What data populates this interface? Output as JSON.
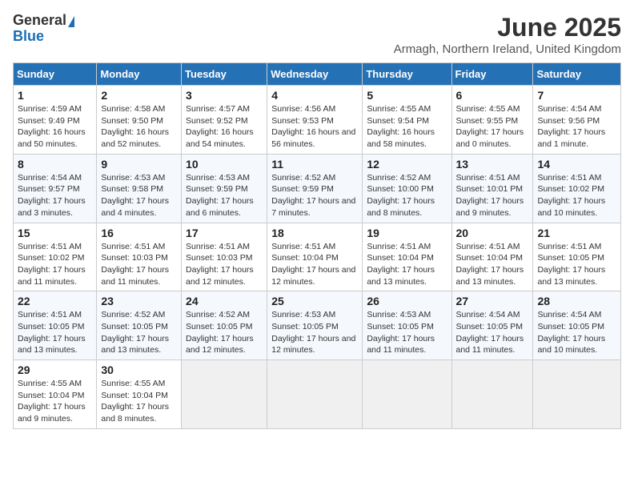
{
  "logo": {
    "general": "General",
    "blue": "Blue"
  },
  "title": "June 2025",
  "subtitle": "Armagh, Northern Ireland, United Kingdom",
  "weekdays": [
    "Sunday",
    "Monday",
    "Tuesday",
    "Wednesday",
    "Thursday",
    "Friday",
    "Saturday"
  ],
  "weeks": [
    [
      {
        "day": "1",
        "sunrise": "4:59 AM",
        "sunset": "9:49 PM",
        "daylight": "16 hours and 50 minutes."
      },
      {
        "day": "2",
        "sunrise": "4:58 AM",
        "sunset": "9:50 PM",
        "daylight": "16 hours and 52 minutes."
      },
      {
        "day": "3",
        "sunrise": "4:57 AM",
        "sunset": "9:52 PM",
        "daylight": "16 hours and 54 minutes."
      },
      {
        "day": "4",
        "sunrise": "4:56 AM",
        "sunset": "9:53 PM",
        "daylight": "16 hours and 56 minutes."
      },
      {
        "day": "5",
        "sunrise": "4:55 AM",
        "sunset": "9:54 PM",
        "daylight": "16 hours and 58 minutes."
      },
      {
        "day": "6",
        "sunrise": "4:55 AM",
        "sunset": "9:55 PM",
        "daylight": "17 hours and 0 minutes."
      },
      {
        "day": "7",
        "sunrise": "4:54 AM",
        "sunset": "9:56 PM",
        "daylight": "17 hours and 1 minute."
      }
    ],
    [
      {
        "day": "8",
        "sunrise": "4:54 AM",
        "sunset": "9:57 PM",
        "daylight": "17 hours and 3 minutes."
      },
      {
        "day": "9",
        "sunrise": "4:53 AM",
        "sunset": "9:58 PM",
        "daylight": "17 hours and 4 minutes."
      },
      {
        "day": "10",
        "sunrise": "4:53 AM",
        "sunset": "9:59 PM",
        "daylight": "17 hours and 6 minutes."
      },
      {
        "day": "11",
        "sunrise": "4:52 AM",
        "sunset": "9:59 PM",
        "daylight": "17 hours and 7 minutes."
      },
      {
        "day": "12",
        "sunrise": "4:52 AM",
        "sunset": "10:00 PM",
        "daylight": "17 hours and 8 minutes."
      },
      {
        "day": "13",
        "sunrise": "4:51 AM",
        "sunset": "10:01 PM",
        "daylight": "17 hours and 9 minutes."
      },
      {
        "day": "14",
        "sunrise": "4:51 AM",
        "sunset": "10:02 PM",
        "daylight": "17 hours and 10 minutes."
      }
    ],
    [
      {
        "day": "15",
        "sunrise": "4:51 AM",
        "sunset": "10:02 PM",
        "daylight": "17 hours and 11 minutes."
      },
      {
        "day": "16",
        "sunrise": "4:51 AM",
        "sunset": "10:03 PM",
        "daylight": "17 hours and 11 minutes."
      },
      {
        "day": "17",
        "sunrise": "4:51 AM",
        "sunset": "10:03 PM",
        "daylight": "17 hours and 12 minutes."
      },
      {
        "day": "18",
        "sunrise": "4:51 AM",
        "sunset": "10:04 PM",
        "daylight": "17 hours and 12 minutes."
      },
      {
        "day": "19",
        "sunrise": "4:51 AM",
        "sunset": "10:04 PM",
        "daylight": "17 hours and 13 minutes."
      },
      {
        "day": "20",
        "sunrise": "4:51 AM",
        "sunset": "10:04 PM",
        "daylight": "17 hours and 13 minutes."
      },
      {
        "day": "21",
        "sunrise": "4:51 AM",
        "sunset": "10:05 PM",
        "daylight": "17 hours and 13 minutes."
      }
    ],
    [
      {
        "day": "22",
        "sunrise": "4:51 AM",
        "sunset": "10:05 PM",
        "daylight": "17 hours and 13 minutes."
      },
      {
        "day": "23",
        "sunrise": "4:52 AM",
        "sunset": "10:05 PM",
        "daylight": "17 hours and 13 minutes."
      },
      {
        "day": "24",
        "sunrise": "4:52 AM",
        "sunset": "10:05 PM",
        "daylight": "17 hours and 12 minutes."
      },
      {
        "day": "25",
        "sunrise": "4:53 AM",
        "sunset": "10:05 PM",
        "daylight": "17 hours and 12 minutes."
      },
      {
        "day": "26",
        "sunrise": "4:53 AM",
        "sunset": "10:05 PM",
        "daylight": "17 hours and 11 minutes."
      },
      {
        "day": "27",
        "sunrise": "4:54 AM",
        "sunset": "10:05 PM",
        "daylight": "17 hours and 11 minutes."
      },
      {
        "day": "28",
        "sunrise": "4:54 AM",
        "sunset": "10:05 PM",
        "daylight": "17 hours and 10 minutes."
      }
    ],
    [
      {
        "day": "29",
        "sunrise": "4:55 AM",
        "sunset": "10:04 PM",
        "daylight": "17 hours and 9 minutes."
      },
      {
        "day": "30",
        "sunrise": "4:55 AM",
        "sunset": "10:04 PM",
        "daylight": "17 hours and 8 minutes."
      },
      null,
      null,
      null,
      null,
      null
    ]
  ]
}
